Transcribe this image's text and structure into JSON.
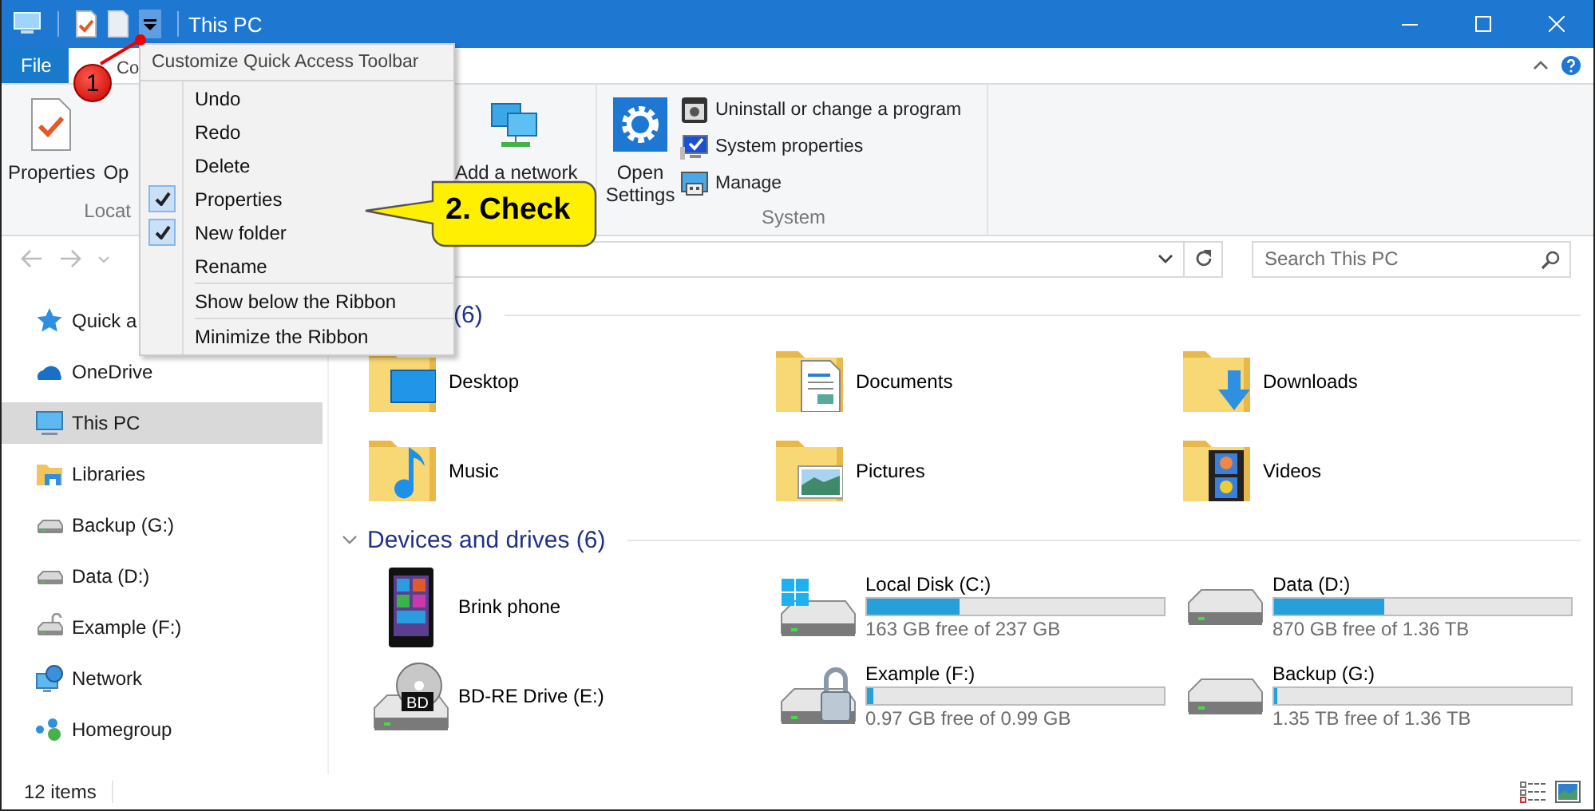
{
  "window": {
    "title": "This PC"
  },
  "ribbon_tabs": [
    {
      "label": "File",
      "kind": "file"
    },
    {
      "label": "Co",
      "kind": "tab"
    }
  ],
  "ribbon": {
    "groups": [
      {
        "label": "Locat",
        "buttons": [
          {
            "label": "Properties",
            "kind": "properties"
          },
          {
            "label": "Op",
            "kind": "plain"
          }
        ]
      },
      {
        "buttons": [
          {
            "label": "Add a network",
            "kind": "network"
          }
        ]
      },
      {
        "label": "System",
        "buttons": [
          {
            "label": "Open Settings",
            "kind": "settings"
          }
        ],
        "links": [
          {
            "label": "Uninstall or change a program",
            "kind": "uninstall"
          },
          {
            "label": "System properties",
            "kind": "sysprops"
          },
          {
            "label": "Manage",
            "kind": "manage"
          }
        ]
      }
    ]
  },
  "menu": {
    "title": "Customize Quick Access Toolbar",
    "items": [
      {
        "label": "Undo",
        "kind": "toggle",
        "checked": false
      },
      {
        "label": "Redo",
        "kind": "toggle",
        "checked": false
      },
      {
        "label": "Delete",
        "kind": "toggle",
        "checked": false
      },
      {
        "label": "Properties",
        "kind": "toggle",
        "checked": true
      },
      {
        "label": "New folder",
        "kind": "toggle",
        "checked": true
      },
      {
        "label": "Rename",
        "kind": "toggle",
        "checked": false
      },
      {
        "label": "Show below the Ribbon",
        "kind": "command"
      },
      {
        "label": "Minimize the Ribbon",
        "kind": "command"
      }
    ]
  },
  "search": {
    "placeholder": "Search This PC"
  },
  "sidebar": {
    "items": [
      {
        "label": "Quick a",
        "kind": "quick",
        "selected": false
      },
      {
        "label": "OneDrive",
        "kind": "cloud",
        "selected": false
      },
      {
        "label": "This PC",
        "kind": "pc",
        "selected": true
      },
      {
        "label": "Libraries",
        "kind": "libraries",
        "selected": false
      },
      {
        "label": "Backup (G:)",
        "kind": "drive",
        "selected": false
      },
      {
        "label": "Data (D:)",
        "kind": "drive",
        "selected": false
      },
      {
        "label": "Example (F:)",
        "kind": "locked_drive",
        "selected": false
      },
      {
        "label": "Network",
        "kind": "network",
        "selected": false
      },
      {
        "label": "Homegroup",
        "kind": "homegroup",
        "selected": false
      }
    ]
  },
  "sections": [
    {
      "heading": "(6)",
      "toggle": false,
      "items": [
        {
          "name": "Desktop",
          "kind": "desktop"
        },
        {
          "name": "Documents",
          "kind": "documents"
        },
        {
          "name": "Downloads",
          "kind": "downloads"
        },
        {
          "name": "Music",
          "kind": "music"
        },
        {
          "name": "Pictures",
          "kind": "pictures"
        },
        {
          "name": "Videos",
          "kind": "videos"
        }
      ]
    },
    {
      "heading": "Devices and drives (6)",
      "toggle": true,
      "items": [
        {
          "name": "Brink phone",
          "kind": "phone"
        },
        {
          "name": "Local Disk (C:)",
          "kind": "system_drive",
          "level": 0.31,
          "reading": "163 GB free of 237 GB"
        },
        {
          "name": "Data (D:)",
          "kind": "drive",
          "level": 0.37,
          "reading": "870 GB free of 1.36 TB"
        },
        {
          "name": "BD-RE Drive (E:)",
          "kind": "optical",
          "badge": "BD"
        },
        {
          "name": "Example (F:)",
          "kind": "locked_drive",
          "level": 0.02,
          "reading": "0.97 GB free of 0.99 GB"
        },
        {
          "name": "Backup (G:)",
          "kind": "drive",
          "level": 0.01,
          "reading": "1.35 TB free of 1.36 TB"
        }
      ]
    }
  ],
  "status_bar": {
    "text": "12 items"
  },
  "annotations": [
    {
      "kind": "marker",
      "text": "1"
    },
    {
      "kind": "callout",
      "text": "2. Check"
    }
  ]
}
